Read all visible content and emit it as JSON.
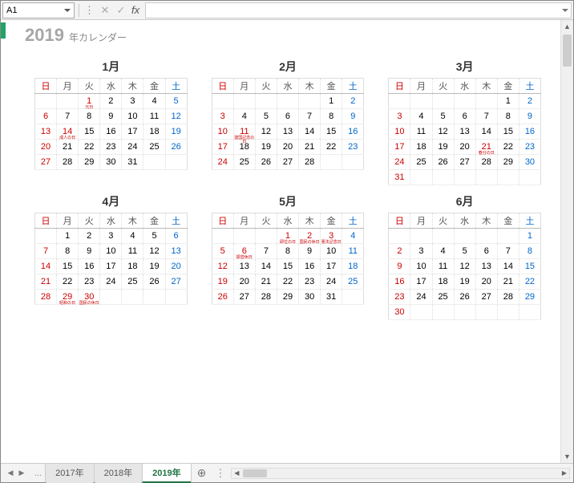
{
  "namebox": "A1",
  "title_year": "2019",
  "title_label": "年カレンダー",
  "weekdays": [
    "日",
    "月",
    "火",
    "水",
    "木",
    "金",
    "土"
  ],
  "months": [
    {
      "name": "1月",
      "offset": 2,
      "days": 31,
      "holidays": [
        1,
        14
      ],
      "hol_labels": {
        "1": "元日",
        "14": "成人の日"
      }
    },
    {
      "name": "2月",
      "offset": 5,
      "days": 28,
      "holidays": [
        11
      ],
      "hol_labels": {
        "11": "建国記念の日"
      }
    },
    {
      "name": "3月",
      "offset": 5,
      "days": 31,
      "holidays": [
        21
      ],
      "hol_labels": {
        "21": "春分の日"
      }
    },
    {
      "name": "4月",
      "offset": 1,
      "days": 30,
      "holidays": [
        29,
        30
      ],
      "hol_labels": {
        "29": "昭和の日",
        "30": "国民の休日"
      }
    },
    {
      "name": "5月",
      "offset": 3,
      "days": 31,
      "holidays": [
        1,
        2,
        3,
        6
      ],
      "hol_labels": {
        "1": "即位の日",
        "2": "国民の休日",
        "3": "憲法記念日",
        "6": "振替休日"
      }
    },
    {
      "name": "6月",
      "offset": 6,
      "days": 30,
      "holidays": [],
      "hol_labels": {}
    }
  ],
  "tabs": {
    "prev": "...",
    "items": [
      "2017年",
      "2018年",
      "2019年"
    ],
    "active": 2
  },
  "chart_data": {
    "type": "table",
    "note": "Japanese 2019 calendar sheet, months Jan–Jun visible"
  }
}
